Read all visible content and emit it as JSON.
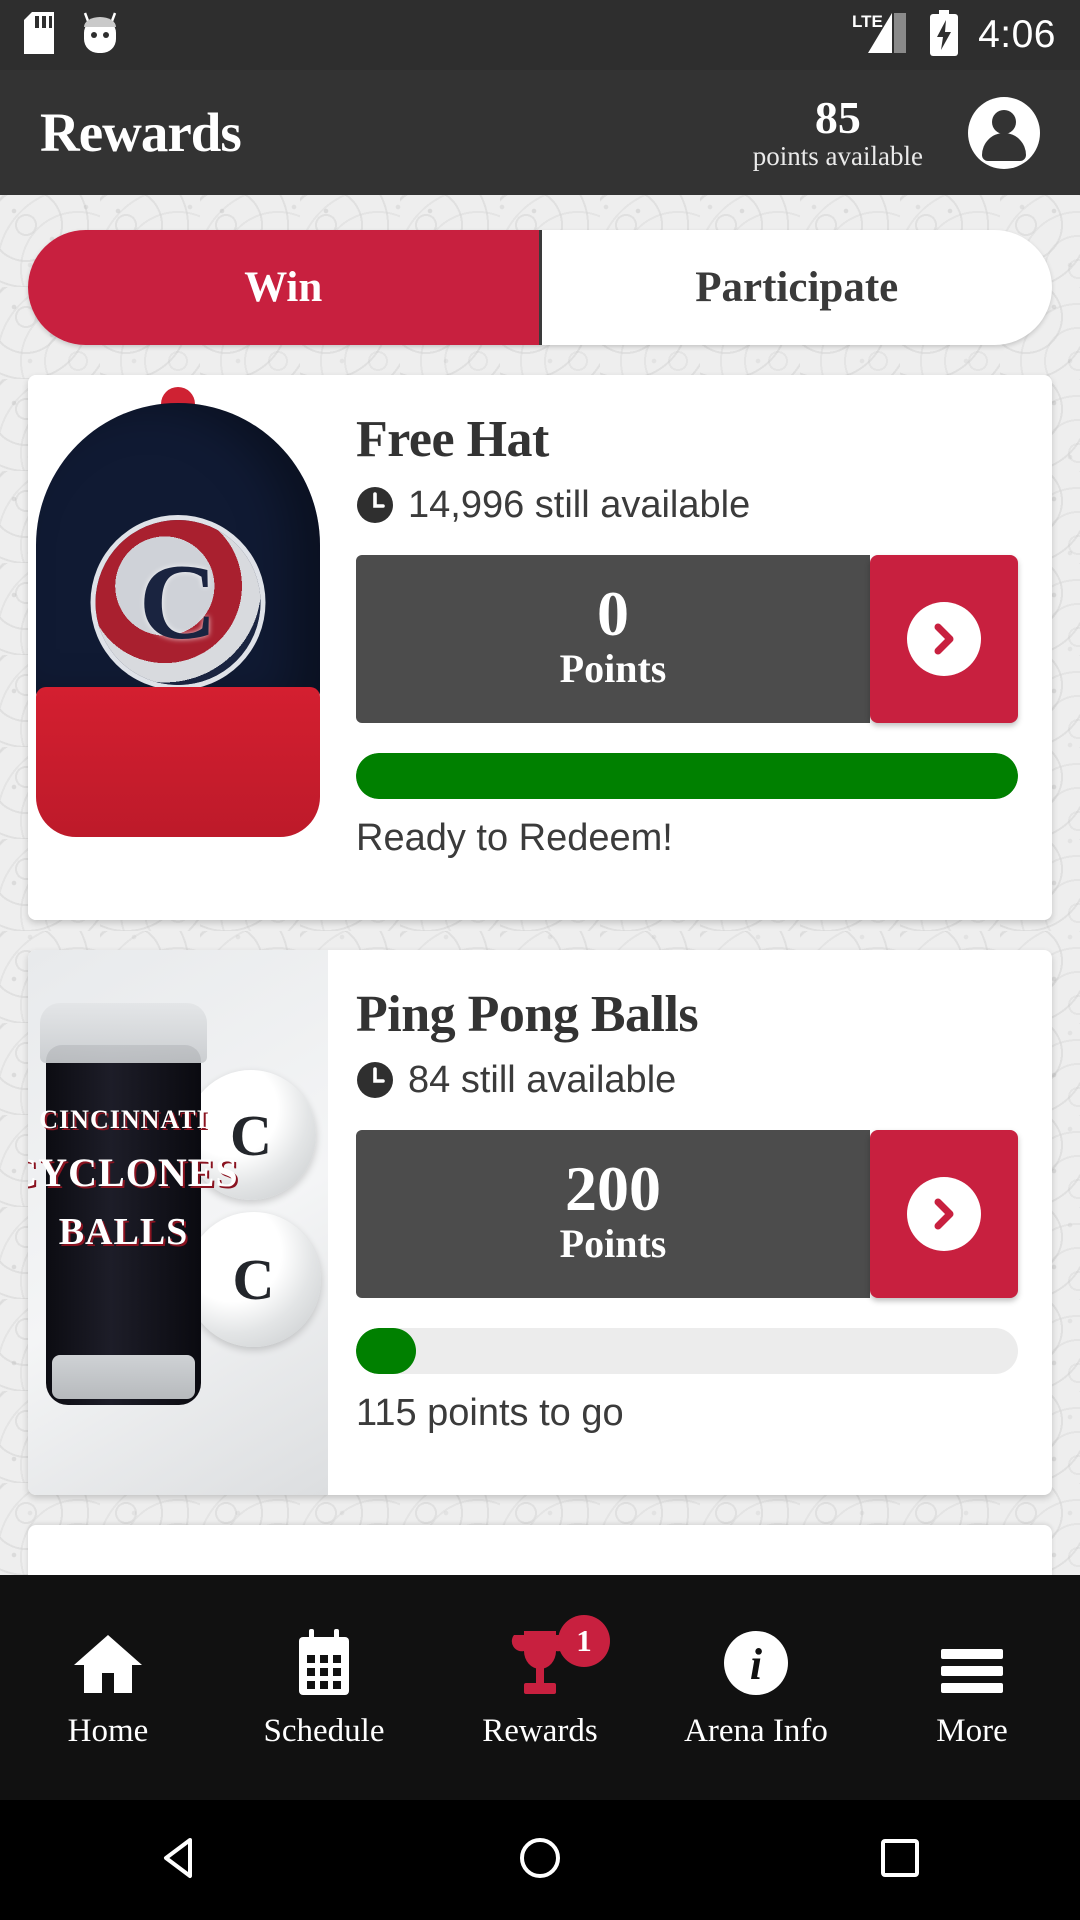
{
  "status_bar": {
    "icons": [
      "sd-card-icon",
      "android-bugdroid-icon"
    ],
    "network": "LTE",
    "battery": "charging",
    "time": "4:06"
  },
  "header": {
    "title": "Rewards",
    "points_value": "85",
    "points_label": "points available",
    "avatar": "account-avatar-icon"
  },
  "tabs": [
    {
      "label": "Win",
      "active": true
    },
    {
      "label": "Participate",
      "active": false
    }
  ],
  "rewards": [
    {
      "title": "Free Hat",
      "availability": "14,996 still available",
      "points_value": "0",
      "points_word": "Points",
      "progress_percent": 100,
      "progress_label": "Ready to Redeem!",
      "image": "cyclones-baseball-hat",
      "action": "chevron-right-icon"
    },
    {
      "title": "Ping Pong Balls",
      "availability": "84 still available",
      "points_value": "200",
      "points_word": "Points",
      "progress_percent": 9,
      "progress_label": "115 points to go",
      "image": "cyclones-ping-pong-balls",
      "product_text": [
        "CINCINNATI",
        "CYCLONES",
        "BALLS"
      ],
      "action": "chevron-right-icon"
    }
  ],
  "bottom_nav": [
    {
      "label": "Home",
      "icon": "home-icon",
      "active": false,
      "badge": null
    },
    {
      "label": "Schedule",
      "icon": "calendar-icon",
      "active": false,
      "badge": null
    },
    {
      "label": "Rewards",
      "icon": "trophy-icon",
      "active": true,
      "badge": "1"
    },
    {
      "label": "Arena Info",
      "icon": "info-icon",
      "active": false,
      "badge": null
    },
    {
      "label": "More",
      "icon": "hamburger-menu-icon",
      "active": false,
      "badge": null
    }
  ],
  "system_nav": [
    {
      "name": "back-button",
      "icon": "triangle-left"
    },
    {
      "name": "home-button",
      "icon": "circle"
    },
    {
      "name": "recents-button",
      "icon": "square"
    }
  ],
  "colors": {
    "brand_red": "#c8203f",
    "header_dark": "#333333",
    "points_box": "#4c4c4c",
    "progress_green": "#008000",
    "nav_black": "#111111"
  }
}
